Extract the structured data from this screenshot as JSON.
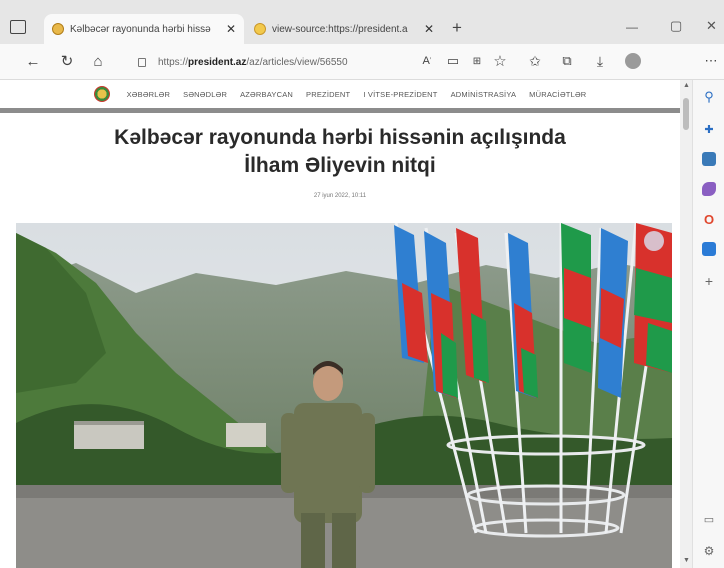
{
  "browser": {
    "tabs": [
      {
        "label": "Kəlbəcər rayonunda hərbi hissə"
      },
      {
        "label": "view-source:https://president.a"
      }
    ],
    "new_tab_symbol": "+",
    "window_controls": {
      "minimize": "—",
      "maximize": "▢",
      "close": "✕"
    },
    "address": {
      "scheme": "https://",
      "host": "president.az",
      "path": "/az/articles/view/56550"
    }
  },
  "site": {
    "nav": [
      "XƏBƏRLƏR",
      "SƏNƏDLƏR",
      "AZƏRBAYCAN",
      "PREZİDENT",
      "I VİTSE-PREZİDENT",
      "ADMİNİSTRASİYA",
      "MÜRACİƏTLƏR"
    ],
    "title_line1": "Kəlbəcər rayonunda hərbi hissənin açılışında",
    "title_line2": "İlham Əliyevin nitqi",
    "date": "27 iyun 2022, 10:11"
  },
  "colors": {
    "flag_blue": "#2f7fd1",
    "flag_red": "#d8312c",
    "flag_green": "#1f9a4a",
    "nav_line": "#8c8c8c"
  }
}
